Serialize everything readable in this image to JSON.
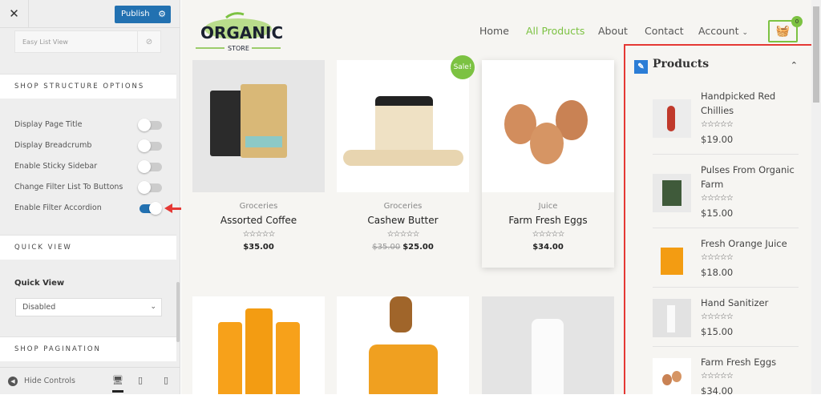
{
  "customizer": {
    "close_label": "✕",
    "publish_label": "Publish",
    "list_view_label": "Easy List View",
    "sections": {
      "structure": "SHOP STRUCTURE OPTIONS",
      "quick_view": "QUICK VIEW",
      "pagination": "SHOP PAGINATION"
    },
    "options": [
      {
        "label": "Display Page Title",
        "enabled": false
      },
      {
        "label": "Display Breadcrumb",
        "enabled": false
      },
      {
        "label": "Enable Sticky Sidebar",
        "enabled": false
      },
      {
        "label": "Change Filter List To Buttons",
        "enabled": false
      },
      {
        "label": "Enable Filter Accordion",
        "enabled": true
      }
    ],
    "quick_view_label": "Quick View",
    "quick_view_value": "Disabled",
    "hide_controls": "Hide Controls",
    "accent": "#2271b1",
    "annotation_color": "#e53935"
  },
  "site": {
    "logo_text": "ORGANIC",
    "logo_sub": "STORE",
    "nav": [
      "Home",
      "All Products",
      "About",
      "Contact",
      "Account"
    ],
    "active_nav": "All Products",
    "accent": "#7cc242",
    "cart_count": "0",
    "sale_label": "Sale!",
    "products": [
      {
        "category": "Groceries",
        "name": "Assorted Coffee",
        "stars": "☆☆☆☆☆",
        "price": "$35.00",
        "old_price": ""
      },
      {
        "category": "Groceries",
        "name": "Cashew Butter",
        "stars": "☆☆☆☆☆",
        "price": "$25.00",
        "old_price": "$35.00"
      },
      {
        "category": "Juice",
        "name": "Farm Fresh Eggs",
        "stars": "☆☆☆☆☆",
        "price": "$34.00",
        "old_price": ""
      }
    ],
    "sidebar": {
      "title": "Products",
      "items": [
        {
          "name": "Handpicked Red Chillies",
          "stars": "☆☆☆☆☆",
          "price": "$19.00"
        },
        {
          "name": "Pulses From Organic Farm",
          "stars": "☆☆☆☆☆",
          "price": "$15.00"
        },
        {
          "name": "Fresh Orange Juice",
          "stars": "☆☆☆☆☆",
          "price": "$18.00"
        },
        {
          "name": "Hand Sanitizer",
          "stars": "☆☆☆☆☆",
          "price": "$15.00"
        },
        {
          "name": "Farm Fresh Eggs",
          "stars": "☆☆☆☆☆",
          "price": "$34.00"
        }
      ]
    }
  }
}
